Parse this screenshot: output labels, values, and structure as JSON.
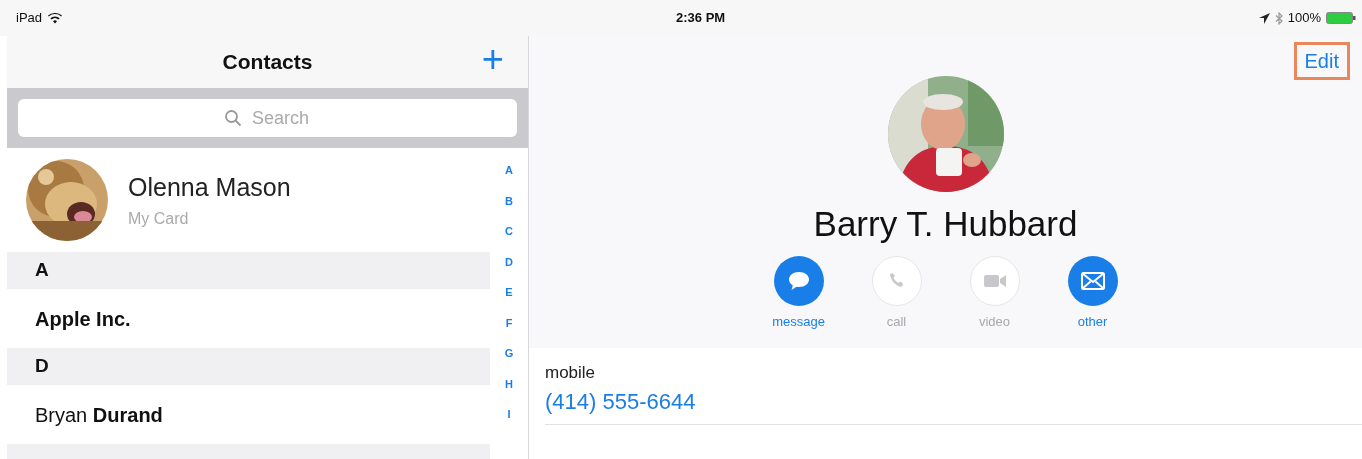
{
  "status_bar": {
    "device": "iPad",
    "time": "2:36 PM",
    "battery": "100%"
  },
  "sidebar": {
    "title": "Contacts",
    "add_label": "+",
    "search": {
      "placeholder": "Search"
    },
    "my_card": {
      "name": "Olenna Mason",
      "subtitle": "My Card"
    },
    "sections": [
      {
        "letter": "A",
        "contacts": [
          {
            "name": "**Apple Inc.**",
            "selected": false
          }
        ]
      },
      {
        "letter": "D",
        "contacts": [
          {
            "name": "Bryan **Durand**",
            "selected": false
          }
        ]
      }
    ],
    "index": [
      "A",
      "B",
      "C",
      "D",
      "E",
      "F",
      "G",
      "H",
      "I"
    ]
  },
  "detail": {
    "edit_label": "Edit",
    "edit_highlighted": true,
    "name": "Barry T. Hubbard",
    "actions": [
      {
        "kind": "message",
        "label": "message",
        "disabled": false
      },
      {
        "kind": "call",
        "label": "call",
        "disabled": true
      },
      {
        "kind": "video",
        "label": "video",
        "disabled": true
      },
      {
        "kind": "mail",
        "label": "other",
        "disabled": false
      }
    ],
    "fields": [
      {
        "label": "mobile",
        "value": "(414) 555-6644"
      }
    ]
  }
}
